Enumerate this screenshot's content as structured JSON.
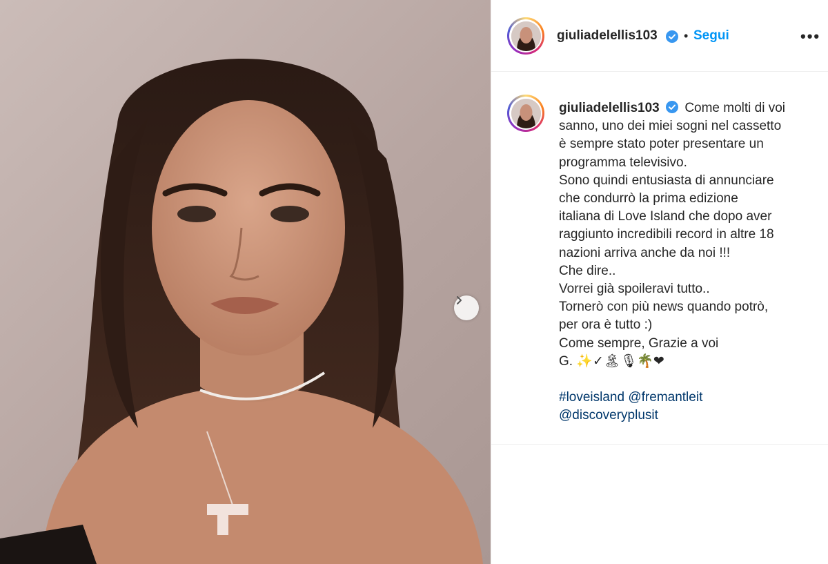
{
  "post": {
    "username": "giuliadelellis103",
    "follow_label": "Segui",
    "separator": "•",
    "more_label": "•••"
  },
  "caption": {
    "username": "giuliadelellis103",
    "first_line": "Come molti di voi",
    "lines": [
      "sanno, uno dei miei sogni nel cassetto",
      "è sempre stato poter presentare un",
      "programma televisivo.",
      "Sono quindi entusiasta di annunciare",
      "che condurrò la prima edizione",
      "italiana di Love Island che dopo aver",
      "raggiunto incredibili record in altre 18",
      "nazioni arriva anche da noi !!!",
      "Che dire..",
      "Vorrei già spoileravi tutto..",
      "Tornerò con più news quando potrò,",
      "per ora è tutto :)",
      "Come sempre, Grazie a voi",
      "G. ✨✓🏝🎙🌴❤"
    ],
    "tags": {
      "hashtag": "#loveisland",
      "mention_1": "@fremantleit",
      "mention_2": "@discoveryplusit"
    }
  },
  "colors": {
    "accent": "#0095f6",
    "link": "#00376b",
    "verified": "#3897f0"
  },
  "icons": {
    "next": "chevron-right-icon",
    "verified": "verified-badge-icon",
    "more": "more-options-icon"
  }
}
